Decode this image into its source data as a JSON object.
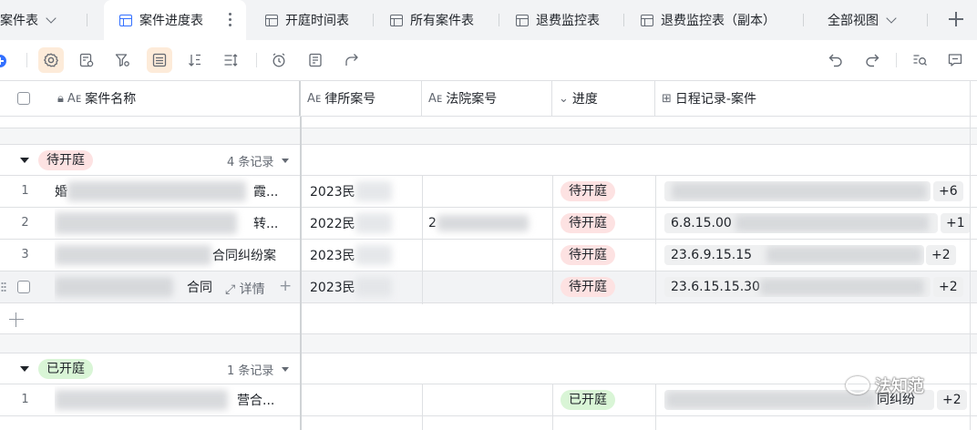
{
  "tabs": {
    "items": [
      {
        "label": "案件表"
      },
      {
        "label": "案件进度表"
      },
      {
        "label": "开庭时间表"
      },
      {
        "label": "所有案件表"
      },
      {
        "label": "退费监控表"
      },
      {
        "label": "退费监控表（副本）"
      },
      {
        "label": "全部视图"
      }
    ]
  },
  "toolbar": {
    "icons": [
      "add-icon",
      "settings-icon",
      "field-settings-icon",
      "filter-icon",
      "group-icon",
      "sort-icon",
      "row-height-icon",
      "reminder-icon",
      "form-icon",
      "share-icon",
      "undo-icon",
      "redo-icon",
      "search-icon",
      "comment-icon"
    ]
  },
  "columns": [
    {
      "label": "案件名称",
      "icon": "text-field-icon"
    },
    {
      "label": "律所案号",
      "icon": "text-field-icon"
    },
    {
      "label": "法院案号",
      "icon": "text-field-icon"
    },
    {
      "label": "进度",
      "icon": "single-select-icon"
    },
    {
      "label": "日程记录-案件",
      "icon": "link-field-icon"
    }
  ],
  "groups": [
    {
      "tag": "待开庭",
      "count": "4 条记录",
      "rows": [
        {
          "no": "1",
          "name_head": "婚",
          "name_tail": "霞...",
          "firm_no": "2023民",
          "court_no": "",
          "status": "待开庭",
          "schedule": "",
          "more": "+6"
        },
        {
          "no": "2",
          "name_head": "",
          "name_tail": "转...",
          "firm_no": "2022民",
          "court_no": "2",
          "status": "待开庭",
          "schedule": "6.8.15.00",
          "more": "+1"
        },
        {
          "no": "3",
          "name_head": "",
          "name_tail": "合同纠纷案",
          "firm_no": "2023民",
          "court_no": "",
          "status": "待开庭",
          "schedule": "23.6.9.15.15",
          "more": "+2"
        },
        {
          "no": "",
          "name_head": "",
          "name_tail": "合同",
          "firm_no": "2023民",
          "court_no": "",
          "status": "待开庭",
          "schedule": "23.6.15.15.30",
          "more": "+2",
          "detail": "详情"
        }
      ]
    },
    {
      "tag": "已开庭",
      "count": "1 条记录",
      "rows": [
        {
          "no": "1",
          "name_head": "",
          "name_tail": "营合...",
          "firm_no": "",
          "court_no": "",
          "status": "已开庭",
          "schedule": "同纠纷",
          "more": "+2"
        }
      ]
    }
  ],
  "watermark": {
    "text": "法知范"
  },
  "colors": {
    "accent": "#3370ff",
    "pending_tag": "#fde2e2",
    "done_tag": "#d9f5d6",
    "toolbar_active": "#fdebd9"
  }
}
